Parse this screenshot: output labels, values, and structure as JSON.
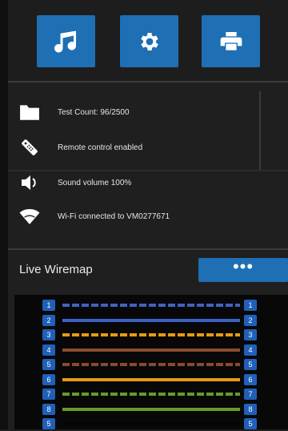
{
  "toolbar": {
    "buttons": [
      {
        "name": "music",
        "icon": "music-note-icon"
      },
      {
        "name": "settings",
        "icon": "gear-icon"
      },
      {
        "name": "print",
        "icon": "printer-icon"
      }
    ]
  },
  "status": {
    "items": [
      {
        "icon": "folder-icon",
        "label": "Test Count: 96/2500"
      },
      {
        "icon": "remote-control-icon",
        "label": "Remote control enabled"
      },
      {
        "icon": "speaker-icon",
        "label": "Sound volume 100%"
      },
      {
        "icon": "wifi-icon",
        "label": "Wi-Fi connected to VM0277671"
      }
    ]
  },
  "wiremap": {
    "title": "Live Wiremap",
    "more_label": "•••",
    "rows": [
      {
        "left": "1",
        "right": "1",
        "color": "#3d63c4",
        "style": "dashed"
      },
      {
        "left": "2",
        "right": "2",
        "color": "#3d63c4",
        "style": "solid"
      },
      {
        "left": "3",
        "right": "3",
        "color": "#e89a10",
        "style": "dashed"
      },
      {
        "left": "4",
        "right": "4",
        "color": "#8a4a30",
        "style": "solid"
      },
      {
        "left": "5",
        "right": "5",
        "color": "#8a4a30",
        "style": "dashed"
      },
      {
        "left": "6",
        "right": "6",
        "color": "#e89a10",
        "style": "solid"
      },
      {
        "left": "7",
        "right": "7",
        "color": "#6a9a2a",
        "style": "dashed"
      },
      {
        "left": "8",
        "right": "8",
        "color": "#6a9a2a",
        "style": "solid"
      },
      {
        "left": "5",
        "right": "5",
        "color": "#000000",
        "style": "solid"
      }
    ]
  },
  "colors": {
    "accent": "#1f6fb5",
    "background": "#1f1f1f",
    "pin": "#2060b8"
  }
}
